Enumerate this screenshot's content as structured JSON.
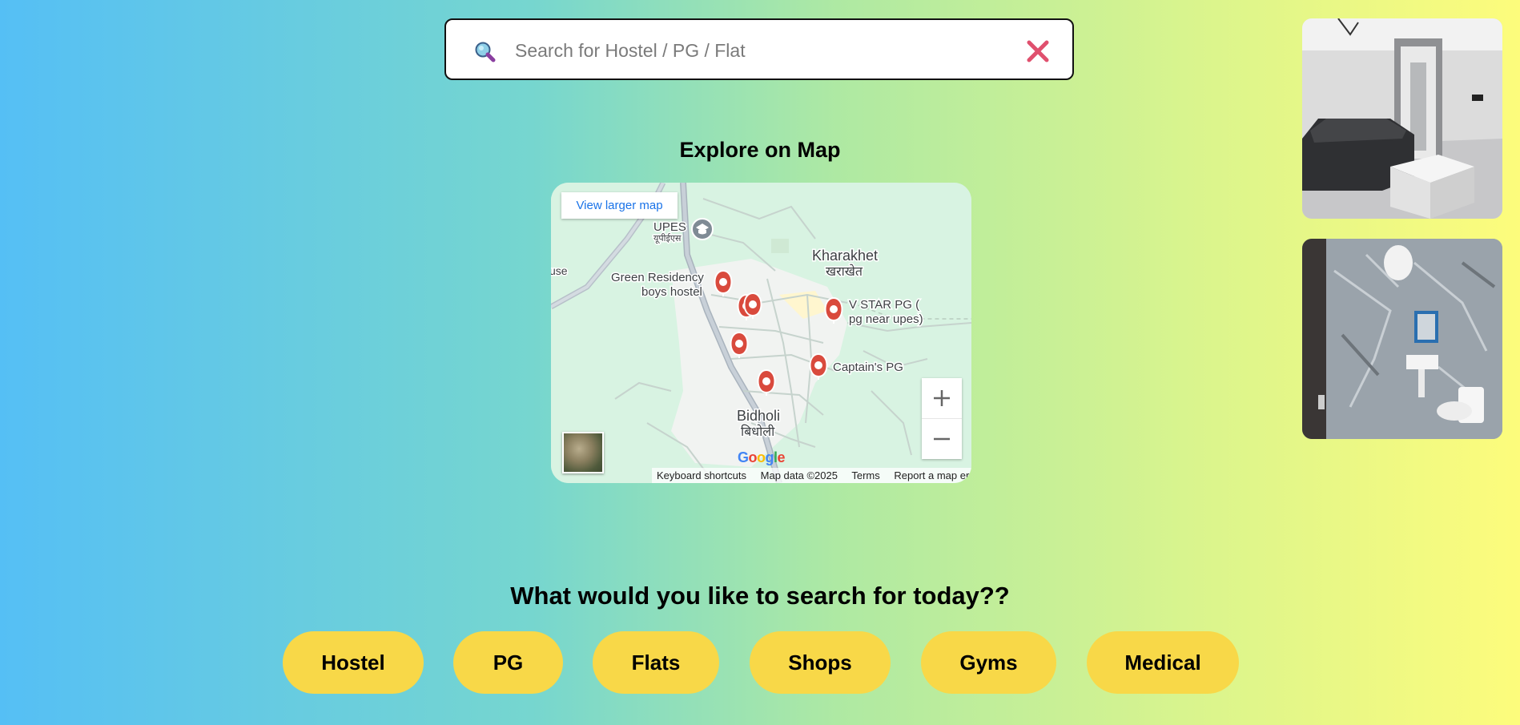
{
  "search": {
    "placeholder": "Search for Hostel / PG / Flat",
    "value": "",
    "icon": "search-icon",
    "clear_icon": "close-icon"
  },
  "map_section": {
    "title": "Explore on Map",
    "view_larger": "View larger map",
    "labels": {
      "upes": "UPES",
      "upes_hi": "यूपीईएस",
      "use": "use",
      "green_residency_1": "Green Residency",
      "green_residency_2": "boys hostel",
      "kharakhet": "Kharakhet",
      "kharakhet_hi": "खराखेत",
      "vstar_1": "V STAR PG (",
      "vstar_2": "pg near upes)",
      "captain": "Captain's PG",
      "bidholi": "Bidholi",
      "bidholi_hi": "बिधोली"
    },
    "attribution": {
      "keyboard": "Keyboard shortcuts",
      "map_data": "Map data ©2025",
      "terms": "Terms",
      "report": "Report a map error"
    },
    "google_letters": [
      "G",
      "o",
      "o",
      "g",
      "l",
      "e"
    ],
    "zoom_in": "+",
    "zoom_out": "−",
    "pin_color": "#d94a3d"
  },
  "question": "What would you like to search for today??",
  "categories": [
    {
      "label": "Hostel"
    },
    {
      "label": "PG"
    },
    {
      "label": "Flats"
    },
    {
      "label": "Shops"
    },
    {
      "label": "Gyms"
    },
    {
      "label": "Medical"
    }
  ],
  "colors": {
    "category_button": "#f8d848",
    "clear_icon": "#e0506e",
    "map_link": "#1a73e8"
  }
}
